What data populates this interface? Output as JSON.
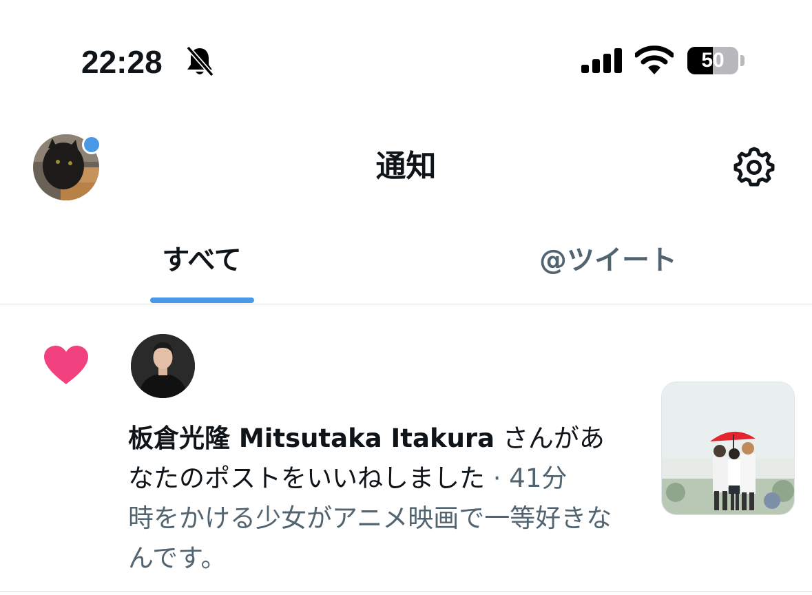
{
  "status_bar": {
    "time": "22:28",
    "battery_level": "50",
    "battery_fraction": 0.5
  },
  "header": {
    "title": "通知"
  },
  "tabs": [
    {
      "label": "すべて",
      "active": true
    },
    {
      "label": "@ツイート",
      "active": false
    }
  ],
  "notifications": [
    {
      "type": "like",
      "actor_name": "板倉光隆 Mitsutaka Itakura",
      "action": " さんがあなたのポストをいいねしました",
      "separator": " · ",
      "time": "41分",
      "post_preview": "時をかける少女がアニメ映画で一等好きなんです。"
    }
  ],
  "colors": {
    "accent": "#4a99e9",
    "like": "#f2417f",
    "text_primary": "#0f1419",
    "text_secondary": "#536471"
  },
  "icons": [
    "bell-slash-icon",
    "cellular-signal-icon",
    "wifi-icon",
    "battery-icon",
    "gear-icon",
    "heart-icon"
  ]
}
